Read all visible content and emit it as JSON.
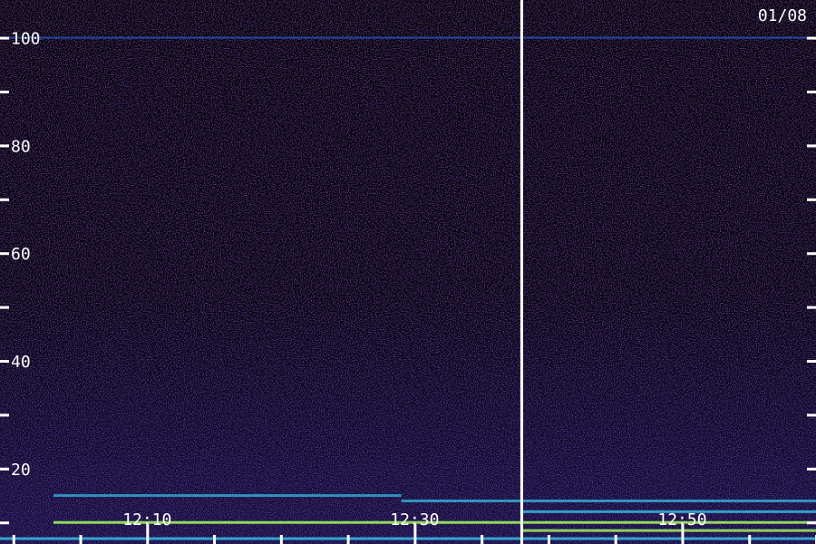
{
  "chart_data": {
    "type": "heatmap",
    "title": "",
    "xlabel": "",
    "ylabel": "",
    "date_label": "01/08",
    "ylim": [
      6,
      107
    ],
    "y_ticks_labeled": [
      20,
      40,
      60,
      80,
      100
    ],
    "y_ticks_minor": [
      10,
      30,
      50,
      70,
      90
    ],
    "x_labels": [
      {
        "time": "12:10",
        "label": "12:10"
      },
      {
        "time": "12:30",
        "label": "12:30"
      },
      {
        "time": "12:50",
        "label": "12:50"
      }
    ],
    "x_ticks_minor": [
      "12:00",
      "12:05",
      "12:10",
      "12:15",
      "12:20",
      "12:25",
      "12:30",
      "12:35",
      "12:40",
      "12:45",
      "12:50",
      "12:55",
      "13:00"
    ],
    "time_start": "11:59",
    "time_end": "13:00",
    "marker_time": "12:38",
    "grid": false,
    "colors": {
      "background": "#000000",
      "noise": "#3a1690",
      "band_cyan": "#36c8f0",
      "band_green": "#9ef060",
      "line_blue": "#3070ff",
      "text": "#ffffff"
    },
    "bands": [
      {
        "freq": 100,
        "t_start": "11:59",
        "t_end": "13:00",
        "level": 0.35,
        "kind": "line"
      },
      {
        "freq": 15,
        "t_start": "12:03",
        "t_end": "12:29",
        "level": 0.55,
        "kind": "cyan"
      },
      {
        "freq": 14,
        "t_start": "12:29",
        "t_end": "13:00",
        "level": 0.6,
        "kind": "cyan"
      },
      {
        "freq": 12,
        "t_start": "12:38",
        "t_end": "13:00",
        "level": 0.7,
        "kind": "cyan"
      },
      {
        "freq": 10,
        "t_start": "12:03",
        "t_end": "13:00",
        "level": 0.9,
        "kind": "green"
      },
      {
        "freq": 8.5,
        "t_start": "12:38",
        "t_end": "13:00",
        "level": 0.85,
        "kind": "green"
      },
      {
        "freq": 7,
        "t_start": "11:59",
        "t_end": "13:00",
        "level": 0.75,
        "kind": "cyan"
      }
    ]
  }
}
